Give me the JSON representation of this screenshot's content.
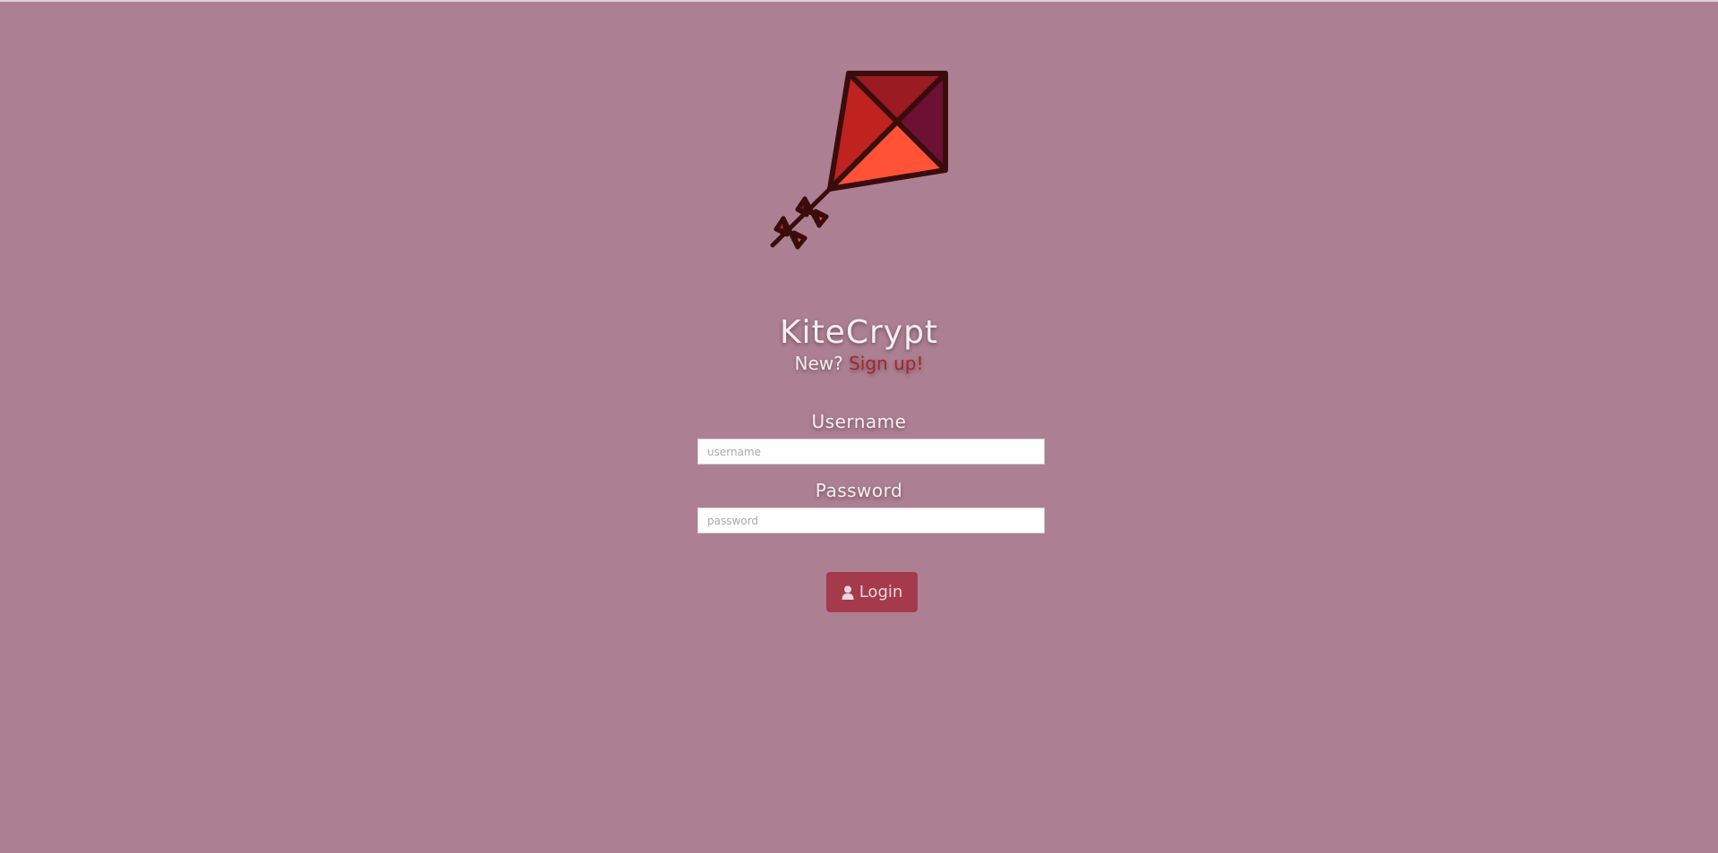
{
  "app": {
    "title": "KiteCrypt",
    "signup_prompt": "New?",
    "signup_link": "Sign up!"
  },
  "form": {
    "username_label": "Username",
    "username_placeholder": "username",
    "password_label": "Password",
    "password_placeholder": "password",
    "login_label": "Login"
  },
  "icons": {
    "logo": "kite-logo-icon",
    "login": "user-icon"
  },
  "colors": {
    "background": "#ac8092",
    "link": "#a3262f",
    "button": "#a63a4d"
  }
}
